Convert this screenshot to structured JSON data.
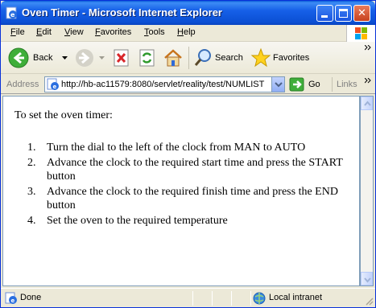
{
  "window": {
    "title": "Oven Timer - Microsoft Internet Explorer"
  },
  "menu": {
    "items": [
      "File",
      "Edit",
      "View",
      "Favorites",
      "Tools",
      "Help"
    ]
  },
  "toolbar": {
    "back_label": "Back",
    "search_label": "Search",
    "favorites_label": "Favorites"
  },
  "address": {
    "label": "Address",
    "url": "http://hb-ac11579:8080/servlet/reality/test/NUMLIST",
    "go_label": "Go",
    "links_label": "Links"
  },
  "content": {
    "intro": "To set the oven timer:",
    "steps": [
      {
        "num": "1.",
        "text": "Turn the dial to the left of the clock from MAN to AUTO"
      },
      {
        "num": "2.",
        "text": "Advance the clock to the required start time and press the START button"
      },
      {
        "num": "3.",
        "text": "Advance the clock to the required finish time and press the END button"
      },
      {
        "num": "4.",
        "text": "Set the oven to the required temperature"
      }
    ]
  },
  "status": {
    "text": "Done",
    "zone": "Local intranet"
  },
  "colors": {
    "titlebar": "#0b4fd4",
    "window_bg": "#ece9d8",
    "content_bg": "#ffffff"
  }
}
